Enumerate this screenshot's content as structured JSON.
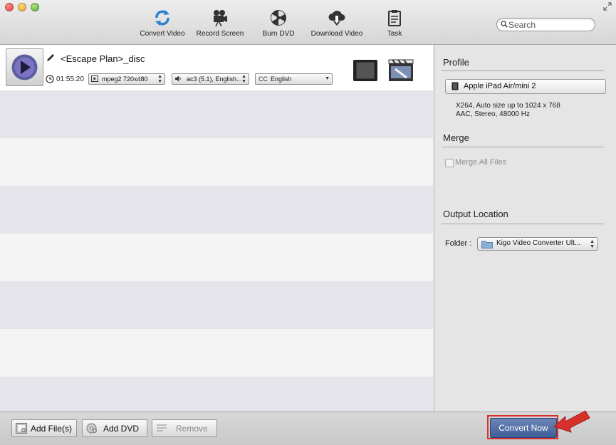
{
  "toolbar": {
    "items": [
      {
        "label": "Convert Video",
        "icon": "convert-icon"
      },
      {
        "label": "Record Screen",
        "icon": "camera-icon"
      },
      {
        "label": "Burn DVD",
        "icon": "burn-disc-icon"
      },
      {
        "label": "Download Video",
        "icon": "cloud-download-icon"
      },
      {
        "label": "Task",
        "icon": "clipboard-icon"
      }
    ],
    "search_placeholder": "Search"
  },
  "file": {
    "title": "<Escape Plan>_disc",
    "duration": "01:55:20",
    "video_track": "mpeg2 720x480",
    "audio_track": "ac3 (5.1), English...",
    "subtitle_prefix": "CC",
    "subtitle": "English"
  },
  "profile": {
    "heading": "Profile",
    "selected": "Apple iPad Air/mini 2",
    "desc_line1": "X264, Auto size up to 1024 x 768",
    "desc_line2": "AAC, Stereo, 48000 Hz"
  },
  "merge": {
    "heading": "Merge",
    "checkbox_label": "Merge All Files"
  },
  "output": {
    "heading": "Output Location",
    "folder_label": "Folder :",
    "folder_value": "Kigo Video Converter Ult..."
  },
  "bottom": {
    "add_files": "Add File(s)",
    "add_dvd": "Add DVD",
    "remove": "Remove",
    "convert_now": "Convert Now"
  },
  "colors": {
    "accent": "#4a66a0",
    "highlight": "#d8312c",
    "stripe": "#e4e4ea"
  }
}
